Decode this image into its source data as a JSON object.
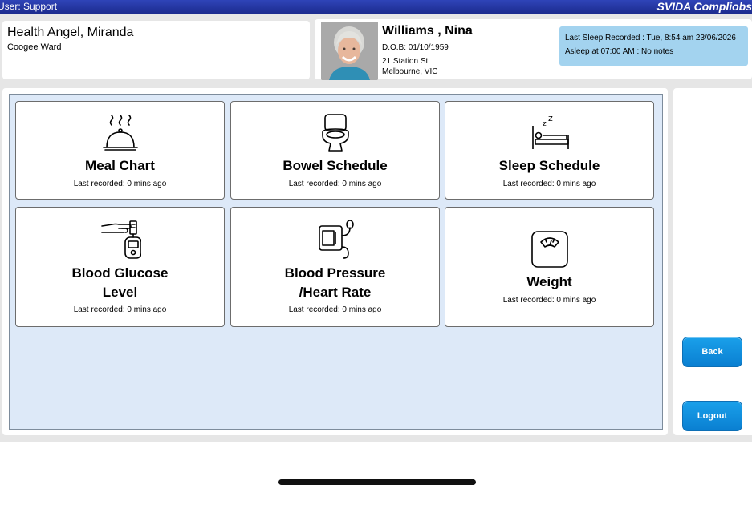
{
  "topbar": {
    "user": "User: Support",
    "brand": "SVIDA Compliobs"
  },
  "staff": {
    "name": "Health Angel, Miranda",
    "ward": "Coogee Ward"
  },
  "patient": {
    "name": "Williams , Nina",
    "dob": "D.O.B: 01/10/1959",
    "address_line1": "21 Station St",
    "address_line2": "Melbourne, VIC"
  },
  "sleep": {
    "last_recorded": "Last Sleep Recorded : Tue, 8:54 am 23/06/2026",
    "asleep": "Asleep at 07:00 AM : No notes"
  },
  "tiles": [
    {
      "title": "Meal Chart",
      "icon": "meal-cloche-icon",
      "sub": "Last recorded: 0 mins ago"
    },
    {
      "title": "Bowel Schedule",
      "icon": "toilet-icon",
      "sub": "Last recorded: 0 mins ago"
    },
    {
      "title": "Sleep Schedule",
      "icon": "bed-sleep-icon",
      "sub": "Last recorded: 0 mins ago"
    },
    {
      "title_line1": "Blood Glucose",
      "title_line2": "Level",
      "icon": "glucose-meter-icon",
      "sub": "Last recorded: 0 mins ago"
    },
    {
      "title_line1": "Blood Pressure",
      "title_line2": "/Heart Rate",
      "icon": "blood-pressure-monitor-icon",
      "sub": "Last recorded: 0 mins ago"
    },
    {
      "title": "Weight",
      "icon": "weighing-scale-icon",
      "sub": "Last recorded: 0 mins ago"
    }
  ],
  "buttons": {
    "back": "Back",
    "logout": "Logout"
  },
  "colors": {
    "topbar": "#1b2a8c",
    "sleep_box": "#a3d3ef",
    "tile_area": "#dde9f8",
    "button": "#0a7fd1"
  }
}
